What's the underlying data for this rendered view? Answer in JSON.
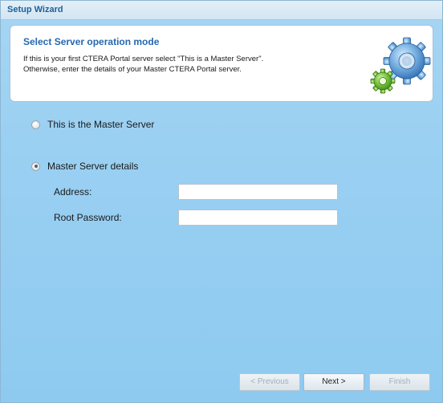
{
  "window": {
    "title": "Setup Wizard"
  },
  "header": {
    "title": "Select Server operation mode",
    "line1": "If this is your first CTERA Portal server select \"This is a Master Server\".",
    "line2": "Otherwise, enter the details of your Master CTERA Portal server.",
    "icon": "gears-icon"
  },
  "options": {
    "master": {
      "label": "This is the Master Server",
      "checked": false
    },
    "details": {
      "label": "Master Server details",
      "checked": true
    }
  },
  "form": {
    "address_label": "Address:",
    "address_value": "",
    "password_label": "Root Password:",
    "password_value": ""
  },
  "buttons": {
    "previous": "< Previous",
    "next": "Next >",
    "finish": "Finish"
  },
  "colors": {
    "title_text": "#1f5f99",
    "header_title": "#2468b1",
    "background": "#9ad0f2"
  }
}
